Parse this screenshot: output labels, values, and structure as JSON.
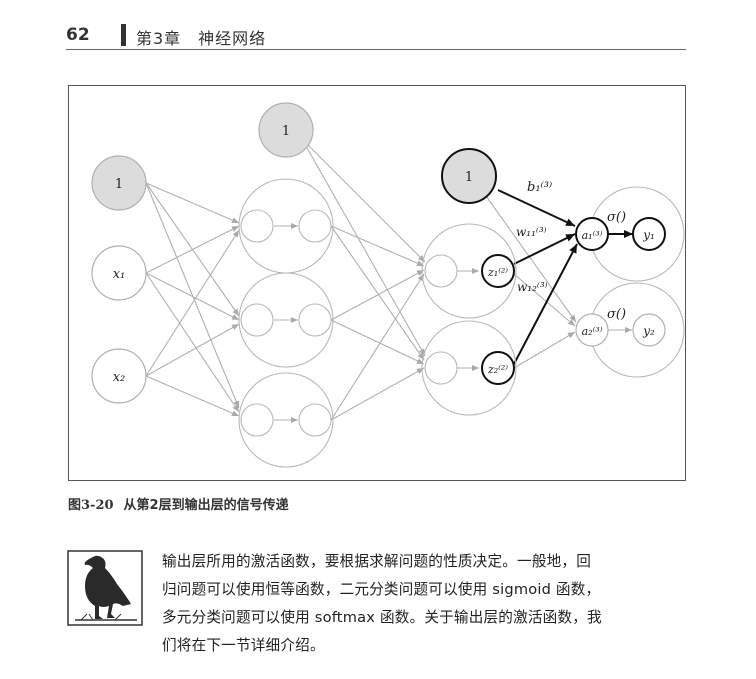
{
  "header": {
    "page_number": "62",
    "chapter": "第3章　神经网络"
  },
  "figure": {
    "caption_number": "图3-20",
    "caption_text": "从第2层到输出层的信号传递",
    "bias_label": "1",
    "inputs": [
      "x₁",
      "x₂"
    ],
    "outputs": [
      "y₁",
      "y₂"
    ],
    "edge_labels": {
      "b": "b₁⁽³⁾",
      "w11": "w₁₁⁽³⁾",
      "w12": "w₁₂⁽³⁾",
      "sigma1": "σ()",
      "sigma2": "σ()"
    },
    "layer2_nodes": [
      "z₁⁽²⁾",
      "z₂⁽²⁾"
    ],
    "output_nodes": [
      "a₁⁽³⁾",
      "a₂⁽³⁾"
    ]
  },
  "note": {
    "lines": [
      "输出层所用的激活函数，要根据求解问题的性质决定。一般地，回",
      "归问题可以使用恒等函数，二元分类问题可以使用 sigmoid 函数，",
      "多元分类问题可以使用 softmax 函数。关于输出层的激活函数，我",
      "们将在下一节详细介绍。"
    ]
  }
}
